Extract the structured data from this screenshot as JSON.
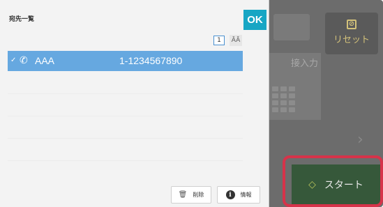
{
  "background": {
    "direct_input_label": "接入力",
    "chevron": "›"
  },
  "reset_button": {
    "icon": "reset-icon",
    "label": "リセット"
  },
  "start_button": {
    "icon": "start-icon",
    "label": "スタート"
  },
  "dialog": {
    "title": "宛先一覧",
    "ok_label": "OK",
    "page_number": "1",
    "sort_label": "ĀĀ",
    "rows": [
      {
        "check": "✓",
        "icon": "phone-icon",
        "name": "AAA",
        "number": "1-1234567890",
        "selected": true
      }
    ],
    "delete_label": "削除",
    "info_label": "情報"
  },
  "colors": {
    "ok": "#17a6c4",
    "selected_row": "#66a8e0",
    "start": "#36583a",
    "highlight": "#d6334a"
  }
}
